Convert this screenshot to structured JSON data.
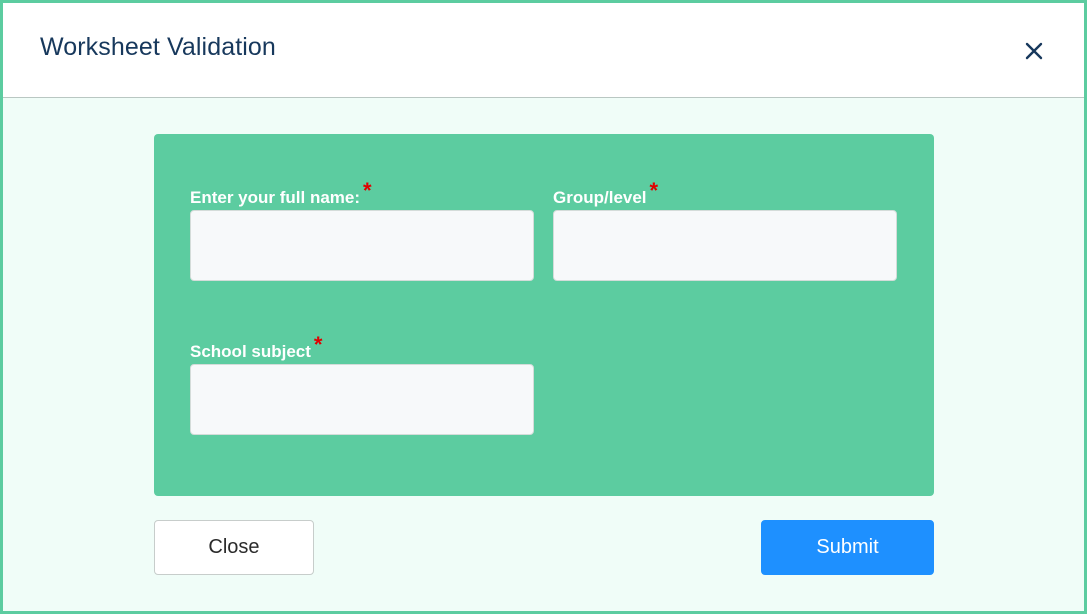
{
  "dialog": {
    "title": "Worksheet Validation",
    "close_icon": "close-icon"
  },
  "form": {
    "fields": [
      {
        "label": "Enter your full name:",
        "required_mark": "*",
        "value": "",
        "placeholder": ""
      },
      {
        "label": "Group/level",
        "required_mark": "*",
        "value": "",
        "placeholder": ""
      },
      {
        "label": "School subject",
        "required_mark": "*",
        "value": "",
        "placeholder": ""
      }
    ],
    "panel_color": "#5ccca0",
    "required_color": "#e00000"
  },
  "buttons": {
    "close_label": "Close",
    "submit_label": "Submit",
    "submit_color": "#1e90ff"
  },
  "colors": {
    "border": "#5ccca0",
    "title": "#17385c",
    "body_background": "#f0fdf8"
  }
}
